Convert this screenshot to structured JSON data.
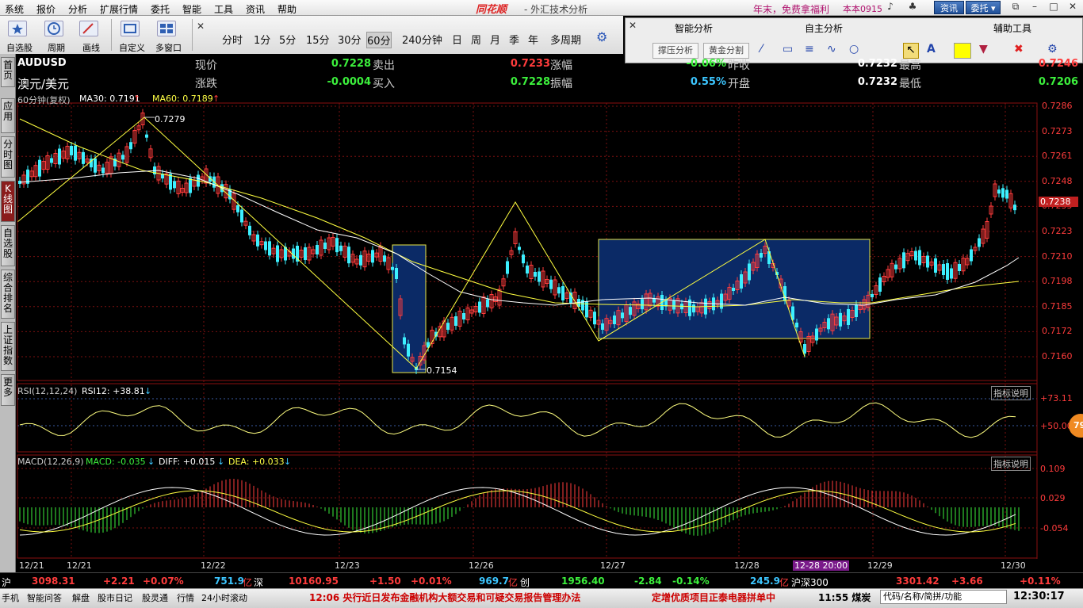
{
  "menubar": {
    "items": [
      "系统",
      "报价",
      "分析",
      "扩展行情",
      "委托",
      "智能",
      "工具",
      "资讯",
      "帮助"
    ],
    "logo": "同花顺",
    "app_title": "- 外汇技术分析",
    "promo": "年末，免费拿福利",
    "version": "本本0915",
    "btn_news": "资讯",
    "btn_trade": "委托 ▾"
  },
  "toolbar": {
    "labels": [
      "自选股",
      "周期",
      "画线",
      "自定义",
      "多窗口"
    ],
    "periods": [
      "分时",
      "1分",
      "5分",
      "15分",
      "30分",
      "60分",
      "240分钟",
      "日",
      "周",
      "月",
      "季",
      "年",
      "多周期"
    ],
    "active_period": "60分"
  },
  "panel": {
    "heads": [
      "智能分析",
      "自主分析",
      "辅助工具"
    ],
    "btn1": "撑压分析",
    "btn2": "黄金分割"
  },
  "sidebar": {
    "tabs": [
      "首页",
      "应用",
      "分时图",
      "K线图",
      "自选股",
      "综合排名",
      "上证指数",
      "更多"
    ]
  },
  "quote": {
    "symbol": "AUDUSD",
    "name": "澳元/美元",
    "labels": [
      "现价",
      "涨跌",
      "卖出",
      "买入",
      "涨幅",
      "振幅",
      "昨收",
      "开盘",
      "最高",
      "最低"
    ],
    "price": "0.7228",
    "change": "-0.0004",
    "ask": "0.7233",
    "bid": "0.7228",
    "change_pct": "-0.06%",
    "amplitude": "0.55%",
    "prev_close": "0.7232",
    "open": "0.7232",
    "high": "0.7246",
    "low": "0.7206"
  },
  "indicators": {
    "ma_label": "60分钟(复权)",
    "ma30": "MA30: 0.7191",
    "ma60": "MA60: 0.7189",
    "rsi_label": "RSI(12,12,24)",
    "rsi12": "RSI12: +38.81",
    "macd_label": "MACD(12,26,9)",
    "macd": "MACD: -0.035",
    "diff": "DIFF: +0.015",
    "dea": "DEA: +0.033",
    "explain": "指标说明",
    "rsi_axis": [
      "+73.11",
      "+50.00"
    ],
    "macd_axis": [
      "0.109",
      "0.029",
      "-0.054"
    ],
    "bubble": "79"
  },
  "price_axis": [
    "0.7286",
    "0.7273",
    "0.7261",
    "0.7248",
    "0.7235",
    "0.7223",
    "0.7210",
    "0.7198",
    "0.7185",
    "0.7172",
    "0.7160"
  ],
  "current_price_tag": "0.7238",
  "annotations": {
    "high": "0.7279",
    "low": "0.7154"
  },
  "dates": [
    "12/21",
    "12/21",
    "12/22",
    "12/23",
    "12/26",
    "12/27",
    "12/28",
    "12-28 20:00",
    "12/29",
    "12/30"
  ],
  "ticker": {
    "sh_label": "沪",
    "sh_value": "3098.31",
    "sh_change": "+2.21",
    "sh_pct": "+0.07%",
    "sh_vol": "751.9",
    "yi": "亿",
    "sz_label": "深",
    "sz_value": "10160.95",
    "sz_change": "+1.50",
    "sz_pct": "+0.01%",
    "sz_vol": "969.7",
    "cy_label": "创",
    "cy_value": "1956.40",
    "cy_change": "-2.84",
    "cy_pct": "-0.14%",
    "cy_vol": "245.9",
    "hs_label": "沪深300",
    "hs_value": "3301.42",
    "hs_change": "+3.66",
    "hs_pct": "+0.11%"
  },
  "status": {
    "tabs": [
      "手机",
      "智能问答",
      "解盘",
      "股市日记",
      "股灵通",
      "行情",
      "24小时滚动"
    ],
    "news1": "12:06 央行近日发布金融机构大额交易和可疑交易报告管理办法",
    "news2": "定增优质项目正泰电器拼单中",
    "news3": "11:55 煤炭",
    "search": "代码/名称/简拼/功能",
    "clock": "12:30:17"
  }
}
